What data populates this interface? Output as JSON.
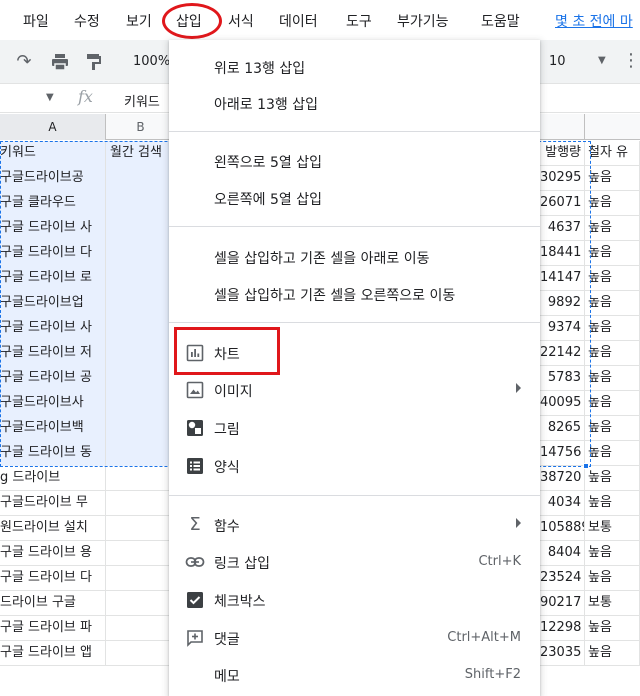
{
  "menubar": {
    "file": "파일",
    "edit": "수정",
    "view": "보기",
    "insert": "삽입",
    "format": "서식",
    "data": "데이터",
    "tools": "도구",
    "addons": "부가기능",
    "help": "도움말",
    "last_edit": "몇 초 전에 마"
  },
  "toolbar": {
    "zoom": "100%",
    "font_size": "10"
  },
  "formula_bar": {
    "fx": "fx",
    "content": "키워드"
  },
  "columns": {
    "a": "A",
    "b": "B",
    "e": "",
    "f": ""
  },
  "rows": [
    {
      "a": "키워드",
      "b": "월간 검색",
      "e": "발행량",
      "f": "철자 유"
    },
    {
      "a": "구글드라이브공",
      "b": "",
      "e": "30295",
      "f": "높음"
    },
    {
      "a": "구글 클라우드",
      "b": "",
      "e": "26071",
      "f": "높음"
    },
    {
      "a": "구글 드라이브 사",
      "b": "",
      "e": "4637",
      "f": "높음"
    },
    {
      "a": "구글 드라이브 다",
      "b": "",
      "e": "18441",
      "f": "높음"
    },
    {
      "a": "구글 드라이브 로",
      "b": "",
      "e": "14147",
      "f": "높음"
    },
    {
      "a": "구글드라이브업",
      "b": "",
      "e": "9892",
      "f": "높음"
    },
    {
      "a": "구글 드라이브 사",
      "b": "",
      "e": "9374",
      "f": "높음"
    },
    {
      "a": "구글 드라이브 저",
      "b": "",
      "e": "22142",
      "f": "높음"
    },
    {
      "a": "구글 드라이브 공",
      "b": "",
      "e": "5783",
      "f": "높음"
    },
    {
      "a": "구글드라이브사",
      "b": "",
      "e": "40095",
      "f": "높음"
    },
    {
      "a": "구글드라이브백",
      "b": "",
      "e": "8265",
      "f": "높음"
    },
    {
      "a": "구글 드라이브 동",
      "b": "",
      "e": "14756",
      "f": "높음"
    },
    {
      "a": "g 드라이브",
      "b": "",
      "e": "38720",
      "f": "높음"
    },
    {
      "a": "구글드라이브 무",
      "b": "",
      "e": "4034",
      "f": "높음"
    },
    {
      "a": "원드라이브 설치",
      "b": "",
      "e": "105889",
      "f": "보통"
    },
    {
      "a": "구글 드라이브 용",
      "b": "",
      "e": "8404",
      "f": "높음"
    },
    {
      "a": "구글 드라이브 다",
      "b": "",
      "e": "23524",
      "f": "높음"
    },
    {
      "a": "드라이브 구글",
      "b": "",
      "e": "90217",
      "f": "보통"
    },
    {
      "a": "구글 드라이브 파",
      "b": "",
      "e": "12298",
      "f": "높음"
    },
    {
      "a": "구글 드라이브 앱",
      "b": "",
      "e": "23035",
      "f": "높음"
    }
  ],
  "insert_menu": {
    "rows_above": "위로 13행 삽입",
    "rows_below": "아래로 13행 삽입",
    "cols_left": "왼쪽으로 5열 삽입",
    "cols_right": "오른쪽에 5열 삽입",
    "cells_shift_down": "셀을 삽입하고 기존 셀을 아래로 이동",
    "cells_shift_right": "셀을 삽입하고 기존 셀을 오른쪽으로 이동",
    "chart": "차트",
    "image": "이미지",
    "drawing": "그림",
    "form": "양식",
    "function": "함수",
    "insert_link": "링크 삽입",
    "insert_link_shortcut": "Ctrl+K",
    "checkbox": "체크박스",
    "comment": "댓글",
    "comment_shortcut": "Ctrl+Alt+M",
    "note": "메모",
    "note_shortcut": "Shift+F2"
  },
  "colors": {
    "accent": "#1a73e8",
    "highlight_red": "#e0171b",
    "selection_bg": "#e8f0fe"
  },
  "icons": {
    "chart": "chart-icon",
    "image": "image-icon",
    "drawing": "drawing-icon",
    "form": "form-icon",
    "function": "sigma-icon",
    "link": "link-icon",
    "checkbox": "checkbox-icon",
    "comment": "comment-icon"
  }
}
